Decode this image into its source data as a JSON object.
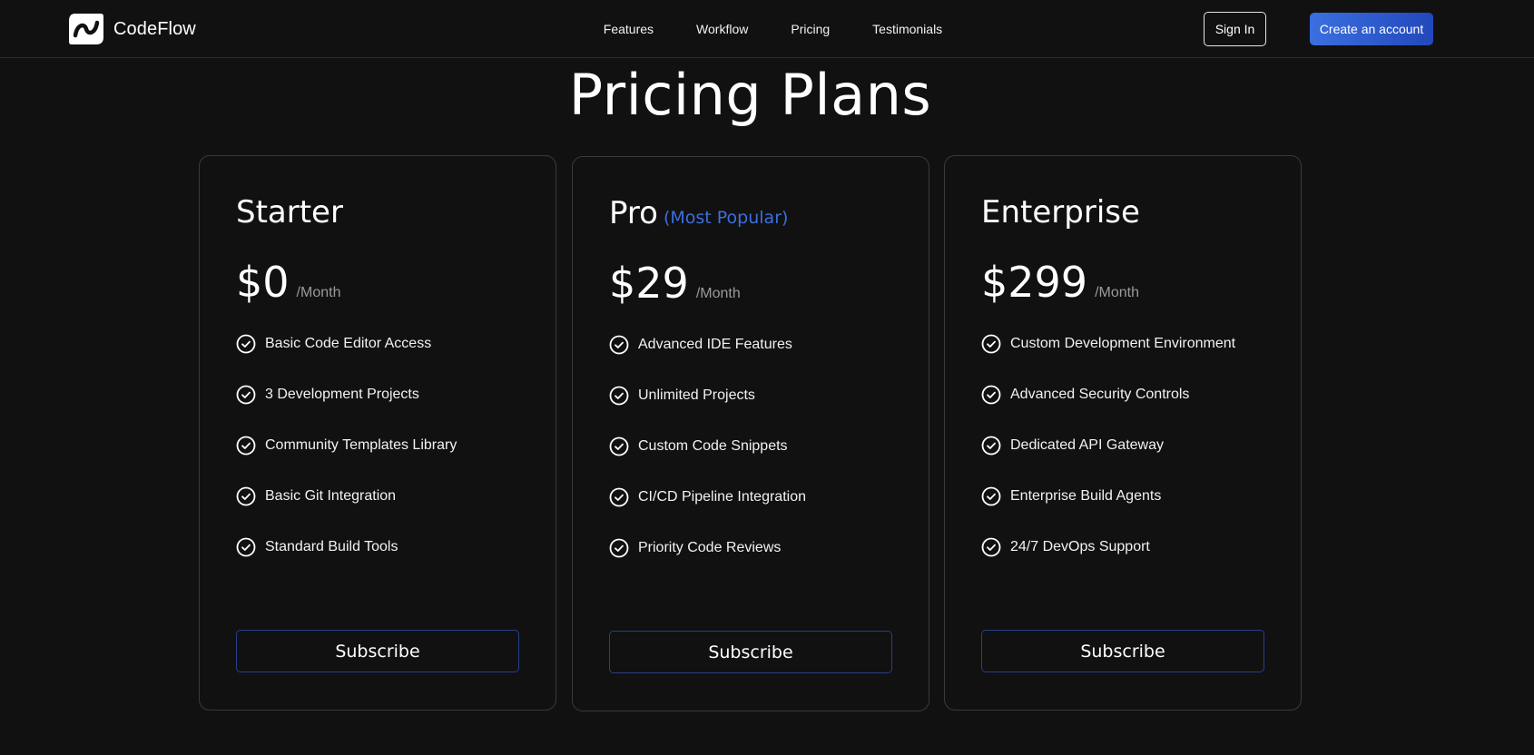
{
  "navbar": {
    "brand": {
      "name": "CodeFlow",
      "logo_icon": "codeflow-logo"
    },
    "links": [
      "Features",
      "Workflow",
      "Pricing",
      "Testimonials"
    ],
    "sign_in_label": "Sign In",
    "create_account_label": "Create an account"
  },
  "page_title": "Pricing Plans",
  "plans": [
    {
      "name": "Starter",
      "tag": "",
      "price": "$0",
      "period": "/Month",
      "features": [
        "Basic Code Editor Access",
        "3 Development Projects",
        "Community Templates Library",
        "Basic Git Integration",
        "Standard Build Tools"
      ],
      "button_label": "Subscribe"
    },
    {
      "name": "Pro",
      "tag": "(Most Popular)",
      "price": "$29",
      "period": "/Month",
      "features": [
        "Advanced IDE Features",
        "Unlimited Projects",
        "Custom Code Snippets",
        "CI/CD Pipeline Integration",
        "Priority Code Reviews"
      ],
      "button_label": "Subscribe"
    },
    {
      "name": "Enterprise",
      "tag": "",
      "price": "$299",
      "period": "/Month",
      "features": [
        "Custom Development Environment",
        "Advanced Security Controls",
        "Dedicated API Gateway",
        "Enterprise Build Agents",
        "24/7 DevOps Support"
      ],
      "button_label": "Subscribe"
    }
  ],
  "icons": {
    "feature_icon": "check-circle-icon"
  },
  "colors": {
    "background": "#111111",
    "accent": "#3b6fe0",
    "card_border": "#3a3a3a",
    "button_border": "#27408f",
    "muted_text": "#9a9a9a"
  }
}
